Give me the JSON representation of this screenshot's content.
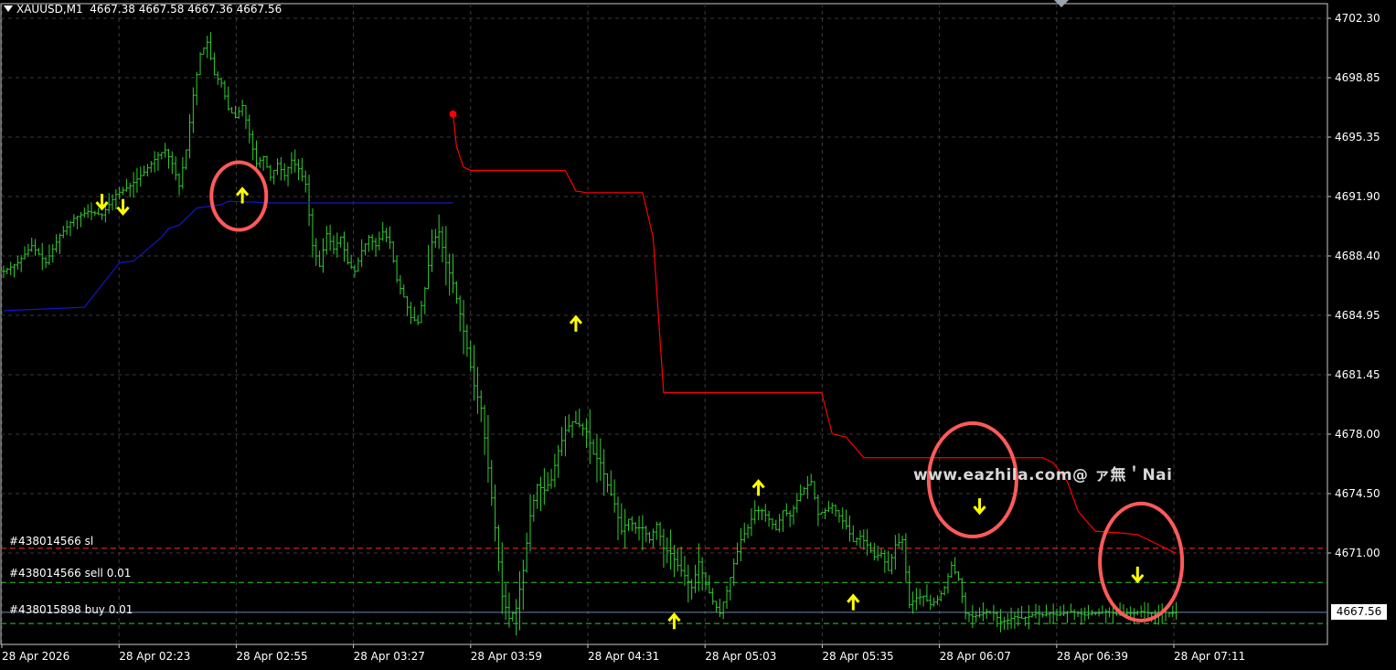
{
  "header": {
    "symbol": "XAUUSD,M1",
    "ohlc": "4667.38 4667.58 4667.36 4667.56"
  },
  "price_levels": [
    {
      "label": "#438014566 sl",
      "price": 4671.3,
      "color": "#ff3030",
      "style": "dashed"
    },
    {
      "label": "#438014566 sell 0.01",
      "price": 4669.3,
      "color": "#2ecc2e",
      "style": "dashed"
    },
    {
      "label": "#438015898 buy 0.01",
      "price": 4667.56,
      "color": "#6a7fa8",
      "style": "solid"
    }
  ],
  "lower_dashed_level": {
    "price": 4666.9,
    "color": "#2ecc2e"
  },
  "current_price": "4667.56",
  "watermark": "www.eazhila.com@ ァ無＇Nai",
  "colors": {
    "candles": "#32cd32",
    "up_trail": "#1515c8",
    "down_trail": "#ff0000",
    "arrow": "#ffff00",
    "circle": "#ff5a5a",
    "grid": "#3a3a3a"
  },
  "chart_data": {
    "type": "line",
    "title": "XAUUSD,M1",
    "ylim": [
      4664.0,
      4703.5
    ],
    "y_ticks": [
      "4702.30",
      "4698.85",
      "4695.35",
      "4691.90",
      "4688.40",
      "4684.95",
      "4681.45",
      "4678.00",
      "4674.50",
      "4671.00",
      "4667.56"
    ],
    "x_ticks": [
      "28 Apr 2026",
      "28 Apr 02:23",
      "28 Apr 02:55",
      "28 Apr 03:27",
      "28 Apr 03:59",
      "28 Apr 04:31",
      "28 Apr 05:03",
      "28 Apr 05:35",
      "28 Apr 06:07",
      "28 Apr 06:39",
      "28 Apr 07:11"
    ],
    "grid": true,
    "series": [
      {
        "kind": "close",
        "x": [
          0,
          4,
          8,
          12,
          16,
          20,
          24,
          28,
          32,
          36,
          40,
          44,
          46,
          48,
          50,
          52,
          54,
          56,
          58,
          60,
          62,
          64,
          66,
          68,
          70,
          72,
          74,
          76,
          78,
          80,
          82,
          84,
          86,
          88,
          90,
          92,
          94,
          96,
          98,
          100,
          102,
          104,
          106,
          108,
          110,
          112,
          114,
          116,
          118,
          120,
          122,
          124,
          126,
          128,
          130,
          132,
          134,
          136,
          138,
          140,
          142,
          144,
          146,
          148,
          150,
          152,
          154,
          156,
          158,
          160,
          162,
          164,
          166,
          168,
          170,
          172,
          174,
          176,
          178,
          180,
          182,
          184,
          186,
          188,
          190,
          192,
          194,
          196,
          198,
          200,
          202,
          204,
          206,
          208,
          210,
          212,
          214,
          216,
          218,
          220,
          222,
          224,
          226,
          228,
          230,
          232,
          234,
          236,
          238,
          240,
          242,
          244,
          246,
          248,
          250,
          252,
          254,
          256,
          258,
          260,
          262,
          264,
          266,
          268,
          270,
          272,
          274,
          276,
          278,
          280,
          282,
          284,
          286,
          288,
          290,
          292,
          294,
          296,
          298,
          300,
          302,
          304,
          306,
          308,
          310,
          312,
          314,
          316,
          318,
          320,
          322,
          324,
          326,
          328,
          330,
          332,
          334
        ],
        "y": [
          4687.5,
          4688.0,
          4689.0,
          4688.0,
          4689.6,
          4690.6,
          4691.0,
          4690.8,
          4692.0,
          4692.5,
          4693.3,
          4694.3,
          4694.6,
          4693.8,
          4692.5,
          4694.6,
          4697.8,
          4700.2,
          4700.9,
          4699.0,
          4698.5,
          4697.0,
          4696.5,
          4697.2,
          4695.5,
          4693.8,
          4694.2,
          4693.0,
          4693.8,
          4693.1,
          4694.0,
          4693.5,
          4692.6,
          4689.0,
          4687.8,
          4689.7,
          4688.8,
          4689.5,
          4688.0,
          4687.5,
          4688.7,
          4689.5,
          4689.0,
          4689.8,
          4689.2,
          4687.0,
          4686.0,
          4684.8,
          4684.5,
          4686.5,
          4689.2,
          4689.8,
          4688.0,
          4686.8,
          4685.0,
          4683.0,
          4680.8,
          4679.5,
          4676.0,
          4672.5,
          4668.5,
          4667.2,
          4667.8,
          4670.0,
          4673.2,
          4675.0,
          4674.7,
          4675.3,
          4677.0,
          4678.2,
          4678.7,
          4678.5,
          4678.1,
          4676.8,
          4676.3,
          4675.0,
          4673.9,
          4672.3,
          4673.0,
          4672.5,
          4672.5,
          4671.8,
          4672.7,
          4671.3,
          4671.0,
          4670.3,
          4669.7,
          4669.0,
          4670.5,
          4669.2,
          4668.2,
          4667.5,
          4668.8,
          4670.4,
          4671.8,
          4672.5,
          4673.5,
          4673.5,
          4673.0,
          4672.4,
          4673.5,
          4673.2,
          4674.1,
          4674.8,
          4675.2,
          4673.3,
          4673.5,
          4673.8,
          4673.2,
          4672.6,
          4671.7,
          4672.0,
          4671.5,
          4670.8,
          4671.0,
          4670.0,
          4671.5,
          4671.8,
          4668.0,
          4668.4,
          4668.5,
          4668.0,
          4668.3,
          4669.0,
          4670.3,
          4669.5,
          4667.5,
          4667.3,
          4667.4,
          4667.6,
          4667.5,
          4667.0,
          4667.1,
          4667.3,
          4667.2,
          4667.3,
          4667.5,
          4667.4,
          4667.5,
          4667.4,
          4667.5,
          4667.6,
          4667.5,
          4667.4,
          4667.5,
          4667.5,
          4667.6,
          4667.5,
          4667.4,
          4667.5,
          4667.5,
          4667.6,
          4667.5,
          4667.5,
          4667.6,
          4667.5,
          4667.56
        ]
      },
      {
        "kind": "up_trail",
        "x": [
          0,
          23,
          33,
          37,
          45,
          47,
          50,
          52,
          55,
          62,
          64,
          77,
          128
        ],
        "y": [
          4685.2,
          4685.4,
          4688.0,
          4688.1,
          4689.5,
          4690.0,
          4690.2,
          4690.6,
          4691.2,
          4691.4,
          4691.6,
          4691.5,
          4691.5
        ]
      },
      {
        "kind": "down_trail",
        "x": [
          128,
          129,
          131,
          133,
          160,
          163,
          166,
          182,
          185,
          188,
          233,
          236,
          240,
          245,
          296,
          299,
          303,
          306,
          308,
          311,
          318,
          323,
          328,
          334
        ],
        "y": [
          4696.7,
          4694.8,
          4693.6,
          4693.4,
          4693.4,
          4692.2,
          4692.1,
          4692.1,
          4689.5,
          4680.4,
          4680.4,
          4678.0,
          4677.8,
          4676.6,
          4676.6,
          4676.3,
          4675.2,
          4673.5,
          4673.0,
          4672.3,
          4672.2,
          4672.1,
          4671.6,
          4671.0
        ]
      }
    ],
    "arrows": [
      {
        "x": 28,
        "price": 4691.6,
        "dir": "down"
      },
      {
        "x": 34,
        "price": 4691.3,
        "dir": "down"
      },
      {
        "x": 68,
        "price": 4691.9,
        "dir": "up"
      },
      {
        "x": 163,
        "price": 4684.4,
        "dir": "up"
      },
      {
        "x": 191,
        "price": 4667.0,
        "dir": "up"
      },
      {
        "x": 215,
        "price": 4674.8,
        "dir": "up"
      },
      {
        "x": 242,
        "price": 4668.1,
        "dir": "up"
      },
      {
        "x": 278,
        "price": 4673.8,
        "dir": "down"
      },
      {
        "x": 323,
        "price": 4669.8,
        "dir": "down"
      }
    ],
    "circles": [
      {
        "x": 67,
        "price": 4691.9,
        "rx": 30,
        "ry": 37
      },
      {
        "x": 276,
        "price": 4675.3,
        "rx": 48,
        "ry": 62
      },
      {
        "x": 324,
        "price": 4670.5,
        "rx": 45,
        "ry": 64
      }
    ],
    "marker": {
      "x": 128,
      "price": 4696.7,
      "color": "#ff0000"
    }
  }
}
